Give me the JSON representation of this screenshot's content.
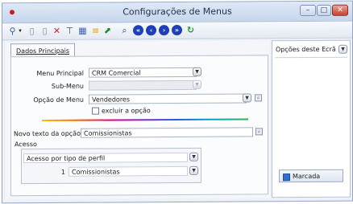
{
  "window": {
    "title": "Configurações de Menus",
    "controls": {
      "minimize": "–",
      "maximize": "□",
      "close": "✕"
    }
  },
  "toolbar": {
    "icons": [
      "search-icon",
      "dropdown-arrow-icon",
      "new-document-icon",
      "delete-icon",
      "insert-row-icon",
      "grid-icon",
      "filter-icon",
      "export-icon",
      "print-preview-icon",
      "nav-first-icon",
      "nav-prev-icon",
      "nav-next-icon",
      "nav-last-icon",
      "refresh-icon"
    ]
  },
  "tabs": {
    "main": "Dados Principais"
  },
  "form": {
    "menu_principal": {
      "label": "Menu Principal",
      "value": "CRM Comercial"
    },
    "sub_menu": {
      "label": "Sub-Menu",
      "value": ""
    },
    "opcao_menu": {
      "label": "Opção de Menu",
      "value": "Vendedores"
    },
    "excluir": {
      "label": "excluir a opção",
      "checked": false
    },
    "novo_texto": {
      "label": "Novo texto da opção",
      "value": "Comissionistas"
    },
    "acesso": {
      "title": "Acesso",
      "tipo": "Acesso por tipo de perfil",
      "row": {
        "num": "1",
        "name": "Comissionistas"
      }
    }
  },
  "side": {
    "title": "Opções deste Ecrã",
    "button": "Marcada"
  }
}
